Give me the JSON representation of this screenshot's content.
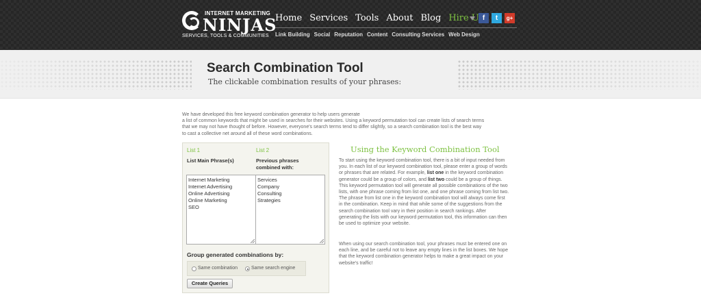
{
  "brand": {
    "top": "INTERNET MARKETING",
    "main": "NINJAS",
    "sub": "SERVICES, TOOLS & COMMUNITIES"
  },
  "nav": {
    "main": [
      "Home",
      "Services",
      "Tools",
      "About",
      "Blog",
      "Hire Us"
    ],
    "sub": [
      "Link Building",
      "Social",
      "Reputation",
      "Content",
      "Consulting Services",
      "Web Design"
    ],
    "social": {
      "facebook": "f",
      "twitter": "t",
      "googleplus": "g+"
    }
  },
  "banner": {
    "title": "Search Combination Tool",
    "subtitle": "The clickable combination results of your phrases:"
  },
  "intro": [
    "We have developed this free keyword combination generator to help users generate",
    "a list of common keywords that might be used in searches for their websites. Using a keyword permutation tool can create lists of search terms",
    "that we may not have thought of before. However, everyone's search terms tend to differ slightly, so a search combination tool is the best way",
    "to cast a collective net around all of these word combinations."
  ],
  "tool": {
    "list1_label": "List 1",
    "list2_label": "List 2",
    "list1_heading": "List Main Phrase(s)",
    "list2_heading": "Previous phrases combined with:",
    "list1_values": [
      "Internet Marketing",
      "Internet Advertising",
      "Online Advertising",
      "Online Marketing",
      "SEO"
    ],
    "list2_values": [
      "Services",
      "Company",
      "Consulting",
      "Strategies"
    ],
    "group_label": "Group generated combinations by:",
    "option1": "Same combination",
    "option2": "Same search engine",
    "selected_option": "Same search engine",
    "button": "Create Queries"
  },
  "info": {
    "title": "Using the Keyword Combination Tool",
    "paragraph1": {
      "a": "To start using the keyword combination tool, there is a bit of input needed from you. In each list of our keyword combination tool, please enter a group of words or phrases that are related. For example,",
      "b1": "list one",
      "c": "in the keyword combination generator could be a group of colors, and",
      "b2": "list two",
      "d": "could be a group of things. This keyword permutation tool will generate all possible combinations of the two lists, with one phrase coming from list one, and one phrase coming from list two. The phrase from list one in the keyword combination tool will always come first in the combination. Keep in mind that while some of the suggestions from the search combination tool vary in their position in search rankings. After generating the lists with our keyword permutation tool, this information can then be used to optimize your website."
    },
    "paragraph2": "When using our search combination tool, your phrases must be entered one on each line, and be careful not to leave any empty lines in the list boxes. We hope that the keyword combination generator helps to make a great impact on your website's traffic!"
  }
}
